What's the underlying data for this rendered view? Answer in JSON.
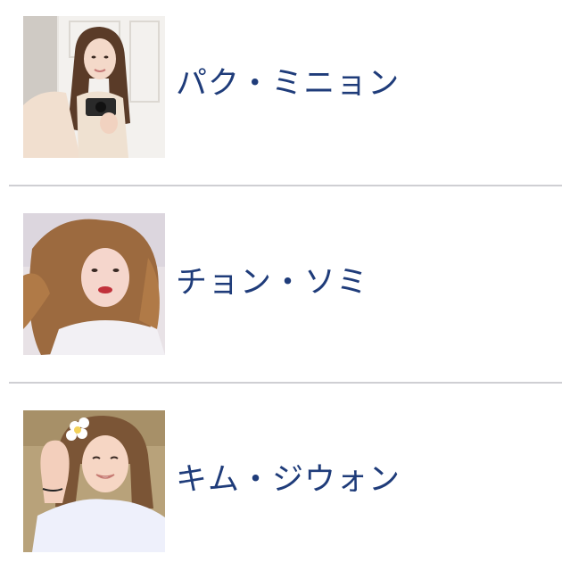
{
  "members": [
    {
      "name": "パク・ミニョン",
      "photo": "photo-park-minyoung"
    },
    {
      "name": "チョン・ソミ",
      "photo": "photo-jeon-somi"
    },
    {
      "name": "キム・ジウォン",
      "photo": "photo-kim-jiwon"
    }
  ],
  "colors": {
    "name_text": "#1f3c7a",
    "divider": "#cfcfd3",
    "background": "#ffffff"
  }
}
